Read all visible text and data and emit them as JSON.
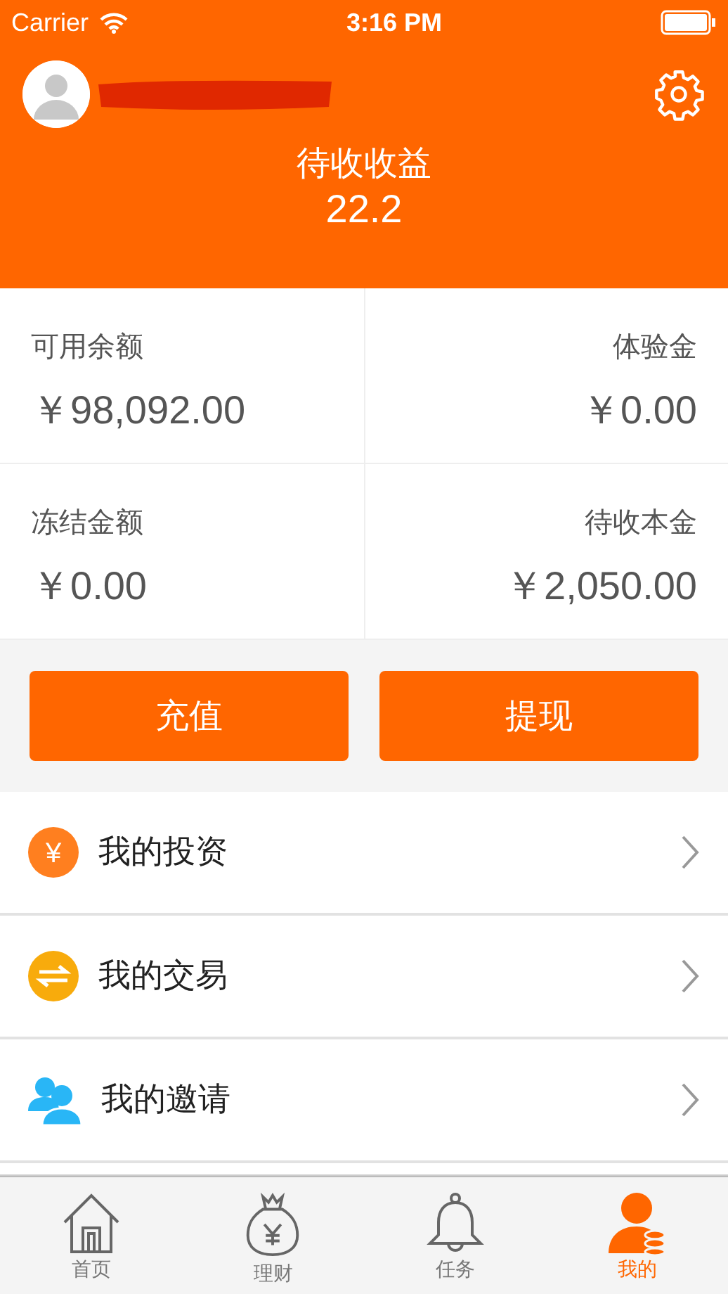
{
  "status_bar": {
    "carrier": "Carrier",
    "time": "3:16 PM"
  },
  "header": {
    "label": "待收收益",
    "value": "22.2"
  },
  "balances": [
    {
      "label": "可用余额",
      "value": "￥98,092.00"
    },
    {
      "label": "体验金",
      "value": "￥0.00"
    },
    {
      "label": "冻结金额",
      "value": "￥0.00"
    },
    {
      "label": "待收本金",
      "value": "￥2,050.00"
    }
  ],
  "buttons": [
    "充值",
    "提现"
  ],
  "menu": [
    {
      "kind": "yen",
      "label": "我的投资",
      "symbol": "¥"
    },
    {
      "kind": "exchange",
      "label": "我的交易"
    },
    {
      "kind": "people",
      "label": "我的邀请"
    }
  ],
  "tabs": [
    {
      "kind": "home",
      "label": "首页",
      "selected": false
    },
    {
      "kind": "bag",
      "label": "理财",
      "selected": false
    },
    {
      "kind": "bell",
      "label": "任务",
      "selected": false
    },
    {
      "kind": "user",
      "label": "我的",
      "selected": true
    }
  ]
}
